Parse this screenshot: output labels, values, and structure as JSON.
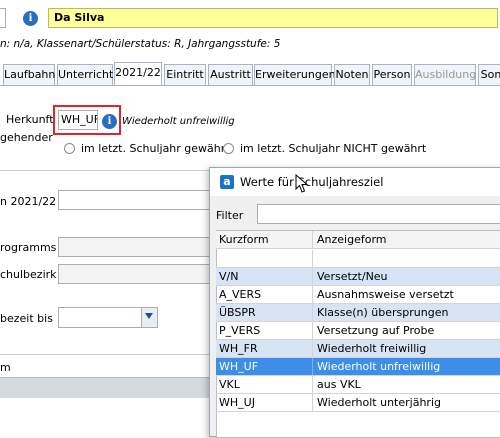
{
  "header": {
    "name_value": "Da Silva",
    "subtitle": "n: n/a, Klassenart/Schülerstatus: R, Jahrgangsstufe: 5"
  },
  "tabs": [
    {
      "label": "Laufbahn"
    },
    {
      "label": "Unterricht"
    },
    {
      "label": "2021/22"
    },
    {
      "label": "Eintritt"
    },
    {
      "label": "Austritt"
    },
    {
      "label": "Erweiterungen"
    },
    {
      "label": "Noten"
    },
    {
      "label": "Person"
    },
    {
      "label": "Ausbildung"
    },
    {
      "label": "Son"
    }
  ],
  "form": {
    "herkunft_label": "Herkunft",
    "herkunft_value": "WH_UF",
    "herkunft_desc": "Wiederholt  unfreiwillig",
    "gehender_label": "gehender",
    "radio1": "im letzt. Schuljahr gewährt",
    "radio2": "im letzt. Schuljahr NICHT gewährt",
    "year_label": "n 2021/22",
    "programms_label": "rogramms",
    "schulbezirk_label": "chulbezirk",
    "bezeit_label": "bezeit bis",
    "bottom_label": "m"
  },
  "dialog": {
    "title": "Werte für Schuljahresziel",
    "filter_label": "Filter",
    "filter_value": "",
    "col_kurzform": "Kurzform",
    "col_anzeigeform": "Anzeigeform",
    "rows": [
      {
        "kurz": "",
        "anzeige": ""
      },
      {
        "kurz": "V/N",
        "anzeige": "Versetzt/Neu"
      },
      {
        "kurz": "A_VERS",
        "anzeige": "Ausnahmsweise versetzt"
      },
      {
        "kurz": "ÜBSPR",
        "anzeige": "Klasse(n) übersprungen"
      },
      {
        "kurz": "P_VERS",
        "anzeige": "Versetzung auf Probe"
      },
      {
        "kurz": "WH_FR",
        "anzeige": "Wiederholt  freiwillig"
      },
      {
        "kurz": "WH_UF",
        "anzeige": "Wiederholt  unfreiwillig"
      },
      {
        "kurz": "VKL",
        "anzeige": "aus VKL"
      },
      {
        "kurz": "WH_UJ",
        "anzeige": "Wiederholt unterjährig"
      }
    ],
    "selected_index": 6
  },
  "colors": {
    "name_bg": "#ffff99",
    "highlight": "#d6e4f5",
    "selected": "#3c8ee8",
    "red_box": "#e0262a"
  }
}
